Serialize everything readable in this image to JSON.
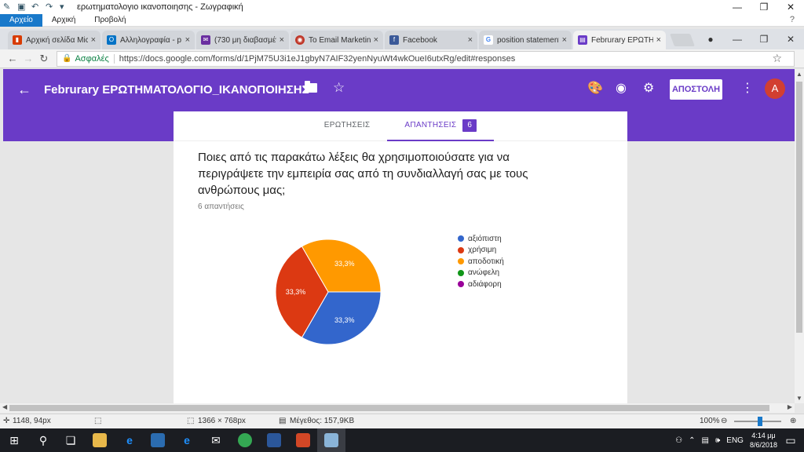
{
  "paint": {
    "title": "ερωτηματολογιο ικανοποιησης - Ζωγραφική",
    "ribbon": [
      "Αρχείο",
      "Αρχική",
      "Προβολή"
    ]
  },
  "browser": {
    "tabs": [
      {
        "label": "Αρχική σελίδα Mic",
        "color": "#d83b01",
        "glyph": "▮"
      },
      {
        "label": "Αλληλογραφία - p",
        "color": "#0072c6",
        "glyph": "O"
      },
      {
        "label": "(730 μη διαβασμέν",
        "color": "#6b2fa0",
        "glyph": "✉"
      },
      {
        "label": "Το Email Marketing",
        "color": "#c0392b",
        "glyph": "◉"
      },
      {
        "label": "Facebook",
        "color": "#3b5998",
        "glyph": "f"
      },
      {
        "label": "position statement",
        "color": "#ffffff",
        "glyph": "G"
      },
      {
        "label": "Februrary ΕΡΩΤΗΜ",
        "color": "#6a3bc7",
        "glyph": "▤"
      }
    ],
    "secure_label": "Ασφαλές",
    "url": "https://docs.google.com/forms/d/1PjM75U3i1eJ1gbyN7AIF32yenNyuWt4wkOueI6utxRg/edit#responses"
  },
  "forms": {
    "title": "Februrary ΕΡΩΤΗΜΑΤΟΛΟΓΙΟ_ΙΚΑΝΟΠΟΙΗΣΗΣ",
    "send_label": "ΑΠΟΣΤΟΛΗ",
    "avatar_letter": "A",
    "tabs": {
      "questions": "ΕΡΩΤΗΣΕΙΣ",
      "responses": "ΑΠΑΝΤΗΣΕΙΣ",
      "responses_count": "6"
    },
    "question": "Ποιες από τις παρακάτω λέξεις θα χρησιμοποιούσατε για να περιγράψετε την εμπειρία σας από τη συνδιαλλαγή σας με τους ανθρώπους μας;",
    "responses_text": "6 απαντήσεις"
  },
  "chart_data": {
    "type": "pie",
    "categories": [
      "αξιόπιστη",
      "χρήσιμη",
      "αποδοτική",
      "ανώφελη",
      "αδιάφορη"
    ],
    "values": [
      33.3,
      33.3,
      33.3,
      0,
      0
    ],
    "labels": [
      "33,3%",
      "33,3%",
      "33,3%",
      "",
      ""
    ],
    "colors": [
      "#3366cc",
      "#dc3912",
      "#ff9900",
      "#109618",
      "#990099"
    ],
    "legend": "right"
  },
  "status": {
    "cursor": "1148, 94px",
    "canvas_size": "1366 × 768px",
    "file_size": "Μέγεθος: 157,9KB",
    "zoom": "100%"
  },
  "taskbar": {
    "lang": "ENG",
    "time": "4:14 μμ",
    "date": "8/6/2018"
  }
}
